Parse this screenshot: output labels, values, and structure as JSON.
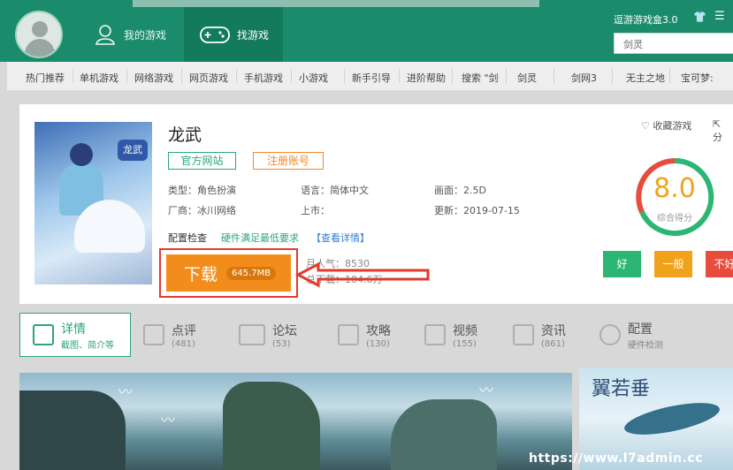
{
  "header": {
    "tab_mygames": "我的游戏",
    "tab_findgames": "找游戏",
    "title": "逗游游戏盒3.0",
    "search_value": "剑灵"
  },
  "categories": [
    "热门推荐",
    "单机游戏",
    "网络游戏",
    "网页游戏",
    "手机游戏",
    "小游戏",
    "新手引导",
    "进阶帮助",
    "搜索 \"剑",
    "剑灵",
    "剑网3",
    "无主之地",
    "宝可梦:"
  ],
  "game": {
    "title": "龙武",
    "official_site": "官方网站",
    "register": "注册账号",
    "type": "类型：角色扮演",
    "lang": "语言：简体中文",
    "screen": "画面：2.5D",
    "vendor": "厂商：冰川网络",
    "launch": "上市：",
    "update": "更新：2019-07-15",
    "config_label": "配置检查",
    "config_status": "硬件满足最低要求",
    "config_detail": "【查看详情】",
    "download_label": "下载",
    "download_size": "645.7MB",
    "popularity": "月人气：8530",
    "downloads": "总下载：104.6万",
    "cover_logo": "龙武"
  },
  "rating": {
    "favorite": "收藏游戏",
    "share": "分",
    "score": "8.0",
    "score_sub": "综合得分",
    "good": "好",
    "normal": "一般",
    "bad": "不好"
  },
  "tabs": [
    {
      "title": "详情",
      "sub": "截图、简介等"
    },
    {
      "title": "点评",
      "sub": "(481)"
    },
    {
      "title": "论坛",
      "sub": "(53)"
    },
    {
      "title": "攻略",
      "sub": "(130)"
    },
    {
      "title": "视频",
      "sub": "(155)"
    },
    {
      "title": "资讯",
      "sub": "(861)"
    },
    {
      "title": "配置",
      "sub": "硬件检测"
    }
  ],
  "side_banner_text": "翼若垂",
  "watermark": "https://www.l7admin.cc",
  "colors": {
    "brand": "#1b8c6b",
    "accent_green": "#2aa57d",
    "orange": "#f28d1c",
    "red": "#e23b2e"
  }
}
